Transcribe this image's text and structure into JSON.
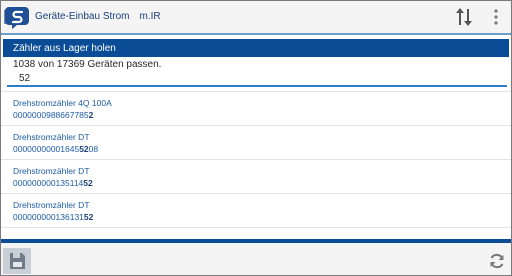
{
  "app": {
    "title": "Geräte-Einbau Strom",
    "user": "m.IR",
    "logo_icon": "app-logo-icon",
    "sort_icon": "sort-up-down-icon",
    "menu_icon": "overflow-menu-icon"
  },
  "panel": {
    "header": "Zähler aus Lager holen",
    "count_text": "1038 von 17369 Geräten passen.",
    "search_value": "52"
  },
  "items": [
    {
      "name": "Drehstromzähler 4Q 100A",
      "code_pre": "0000000988667785",
      "code_hl": "2",
      "code_post": ""
    },
    {
      "name": "Drehstromzähler DT",
      "code_pre": "00000000001645",
      "code_hl": "52",
      "code_post": "08"
    },
    {
      "name": "Drehstromzähler DT",
      "code_pre": "000000000135114",
      "code_hl": "52",
      "code_post": ""
    },
    {
      "name": "Drehstromzähler DT",
      "code_pre": "000000000136131",
      "code_hl": "52",
      "code_post": ""
    }
  ],
  "footer": {
    "save_icon": "save-icon",
    "refresh_icon": "refresh-icon"
  },
  "colors": {
    "accent": "#0a4c96",
    "link": "#1d5da6",
    "underline": "#2d7fc3"
  }
}
